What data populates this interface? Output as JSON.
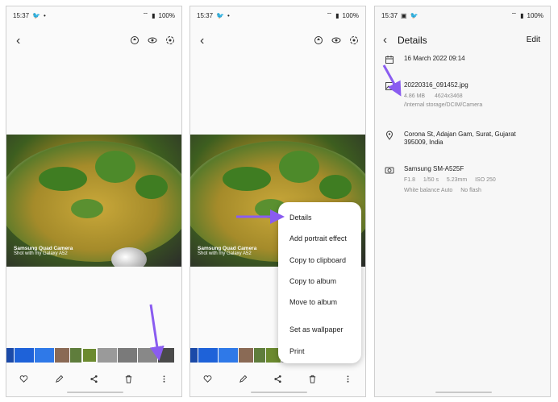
{
  "panels": [
    {
      "status": {
        "time": "15:37",
        "battery": "100%"
      },
      "photo_watermark": {
        "line1": "Samsung Quad Camera",
        "line2": "Shot with my Galaxy A52"
      }
    },
    {
      "status": {
        "time": "15:37",
        "battery": "100%"
      },
      "photo_watermark": {
        "line1": "Samsung Quad Camera",
        "line2": "Shot with my Galaxy A52"
      },
      "menu": {
        "items": [
          "Details",
          "Add portrait effect",
          "Copy to clipboard",
          "Copy to album",
          "Move to album",
          "Set as wallpaper",
          "Print"
        ]
      }
    },
    {
      "status": {
        "time": "15:37",
        "battery": "100%"
      },
      "details": {
        "title": "Details",
        "edit_label": "Edit",
        "date": "16 March 2022 09:14",
        "file_name": "20220316_091452.jpg",
        "file_size": "4.86 MB",
        "resolution": "4624x3468",
        "path": "/Internal storage/DCIM/Camera",
        "location": "Corona St, Adajan Gam, Surat, Gujarat 395009, India",
        "device": "Samsung SM-A525F",
        "aperture": "F1.8",
        "shutter": "1/50 s",
        "focal": "5.23mm",
        "iso": "ISO 250",
        "white_balance": "White balance Auto",
        "flash": "No flash"
      }
    }
  ],
  "icons": {
    "top": [
      "rotate-icon",
      "eye-icon",
      "remaster-icon"
    ],
    "bottom": [
      "heart-icon",
      "pencil-icon",
      "share-icon",
      "trash-icon",
      "more-icon"
    ]
  },
  "colors": {
    "accent_arrow": "#8a5cf0"
  }
}
